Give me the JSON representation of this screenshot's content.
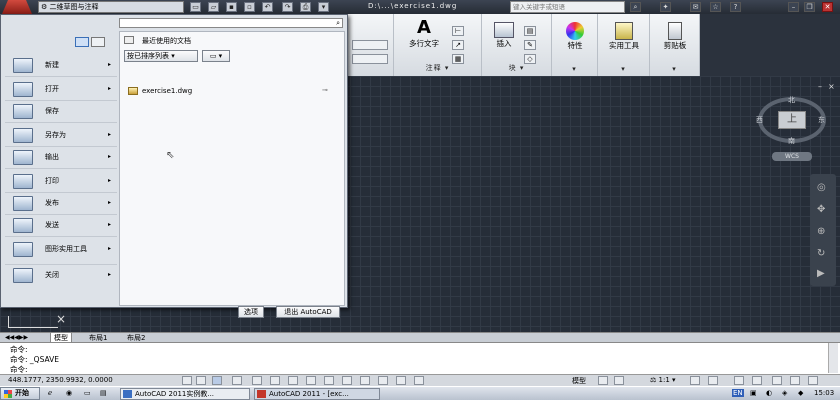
{
  "titlebar": {
    "workspace": "二维草图与注释",
    "document_title": "D:\\...\\exercise1.dwg",
    "search_placeholder": "键入关键字或短语"
  },
  "ribbon": {
    "groups": [
      {
        "label": "注释",
        "big_button": "多行文字"
      },
      {
        "label": "块",
        "big_button": "插入"
      },
      {
        "label": "",
        "big_button": "特性"
      },
      {
        "label": "",
        "big_button": "实用工具"
      },
      {
        "label": "",
        "big_button": "剪贴板"
      }
    ]
  },
  "app_menu": {
    "items": [
      {
        "label": "新建"
      },
      {
        "label": "打开"
      },
      {
        "label": "保存"
      },
      {
        "label": "另存为"
      },
      {
        "label": "输出"
      },
      {
        "label": "打印"
      },
      {
        "label": "发布"
      },
      {
        "label": "发送"
      },
      {
        "label": "图形实用工具"
      },
      {
        "label": "关闭"
      }
    ],
    "recent": {
      "header": "最近使用的文档",
      "sort_label": "按已排序列表",
      "files": [
        "exercise1.dwg"
      ]
    },
    "options_label": "选项",
    "exit_label": "退出 AutoCAD"
  },
  "compass": {
    "north": "北",
    "south": "南",
    "east": "东",
    "west": "西",
    "face": "上",
    "wcs": "WCS"
  },
  "layout_tabs": [
    "模型",
    "布局1",
    "布局2"
  ],
  "command_line": {
    "lines": [
      "命令:",
      "命令: _QSAVE",
      "命令:"
    ]
  },
  "status": {
    "coords": "448.1777, 2350.9932, 0.0000",
    "model_label": "模型",
    "scale": "1:1"
  },
  "taskbar": {
    "start": "开始",
    "tasks": [
      "AutoCAD 2011实例教...",
      "AutoCAD 2011 - [exc..."
    ],
    "ime": "EN",
    "clock": "15:03"
  }
}
